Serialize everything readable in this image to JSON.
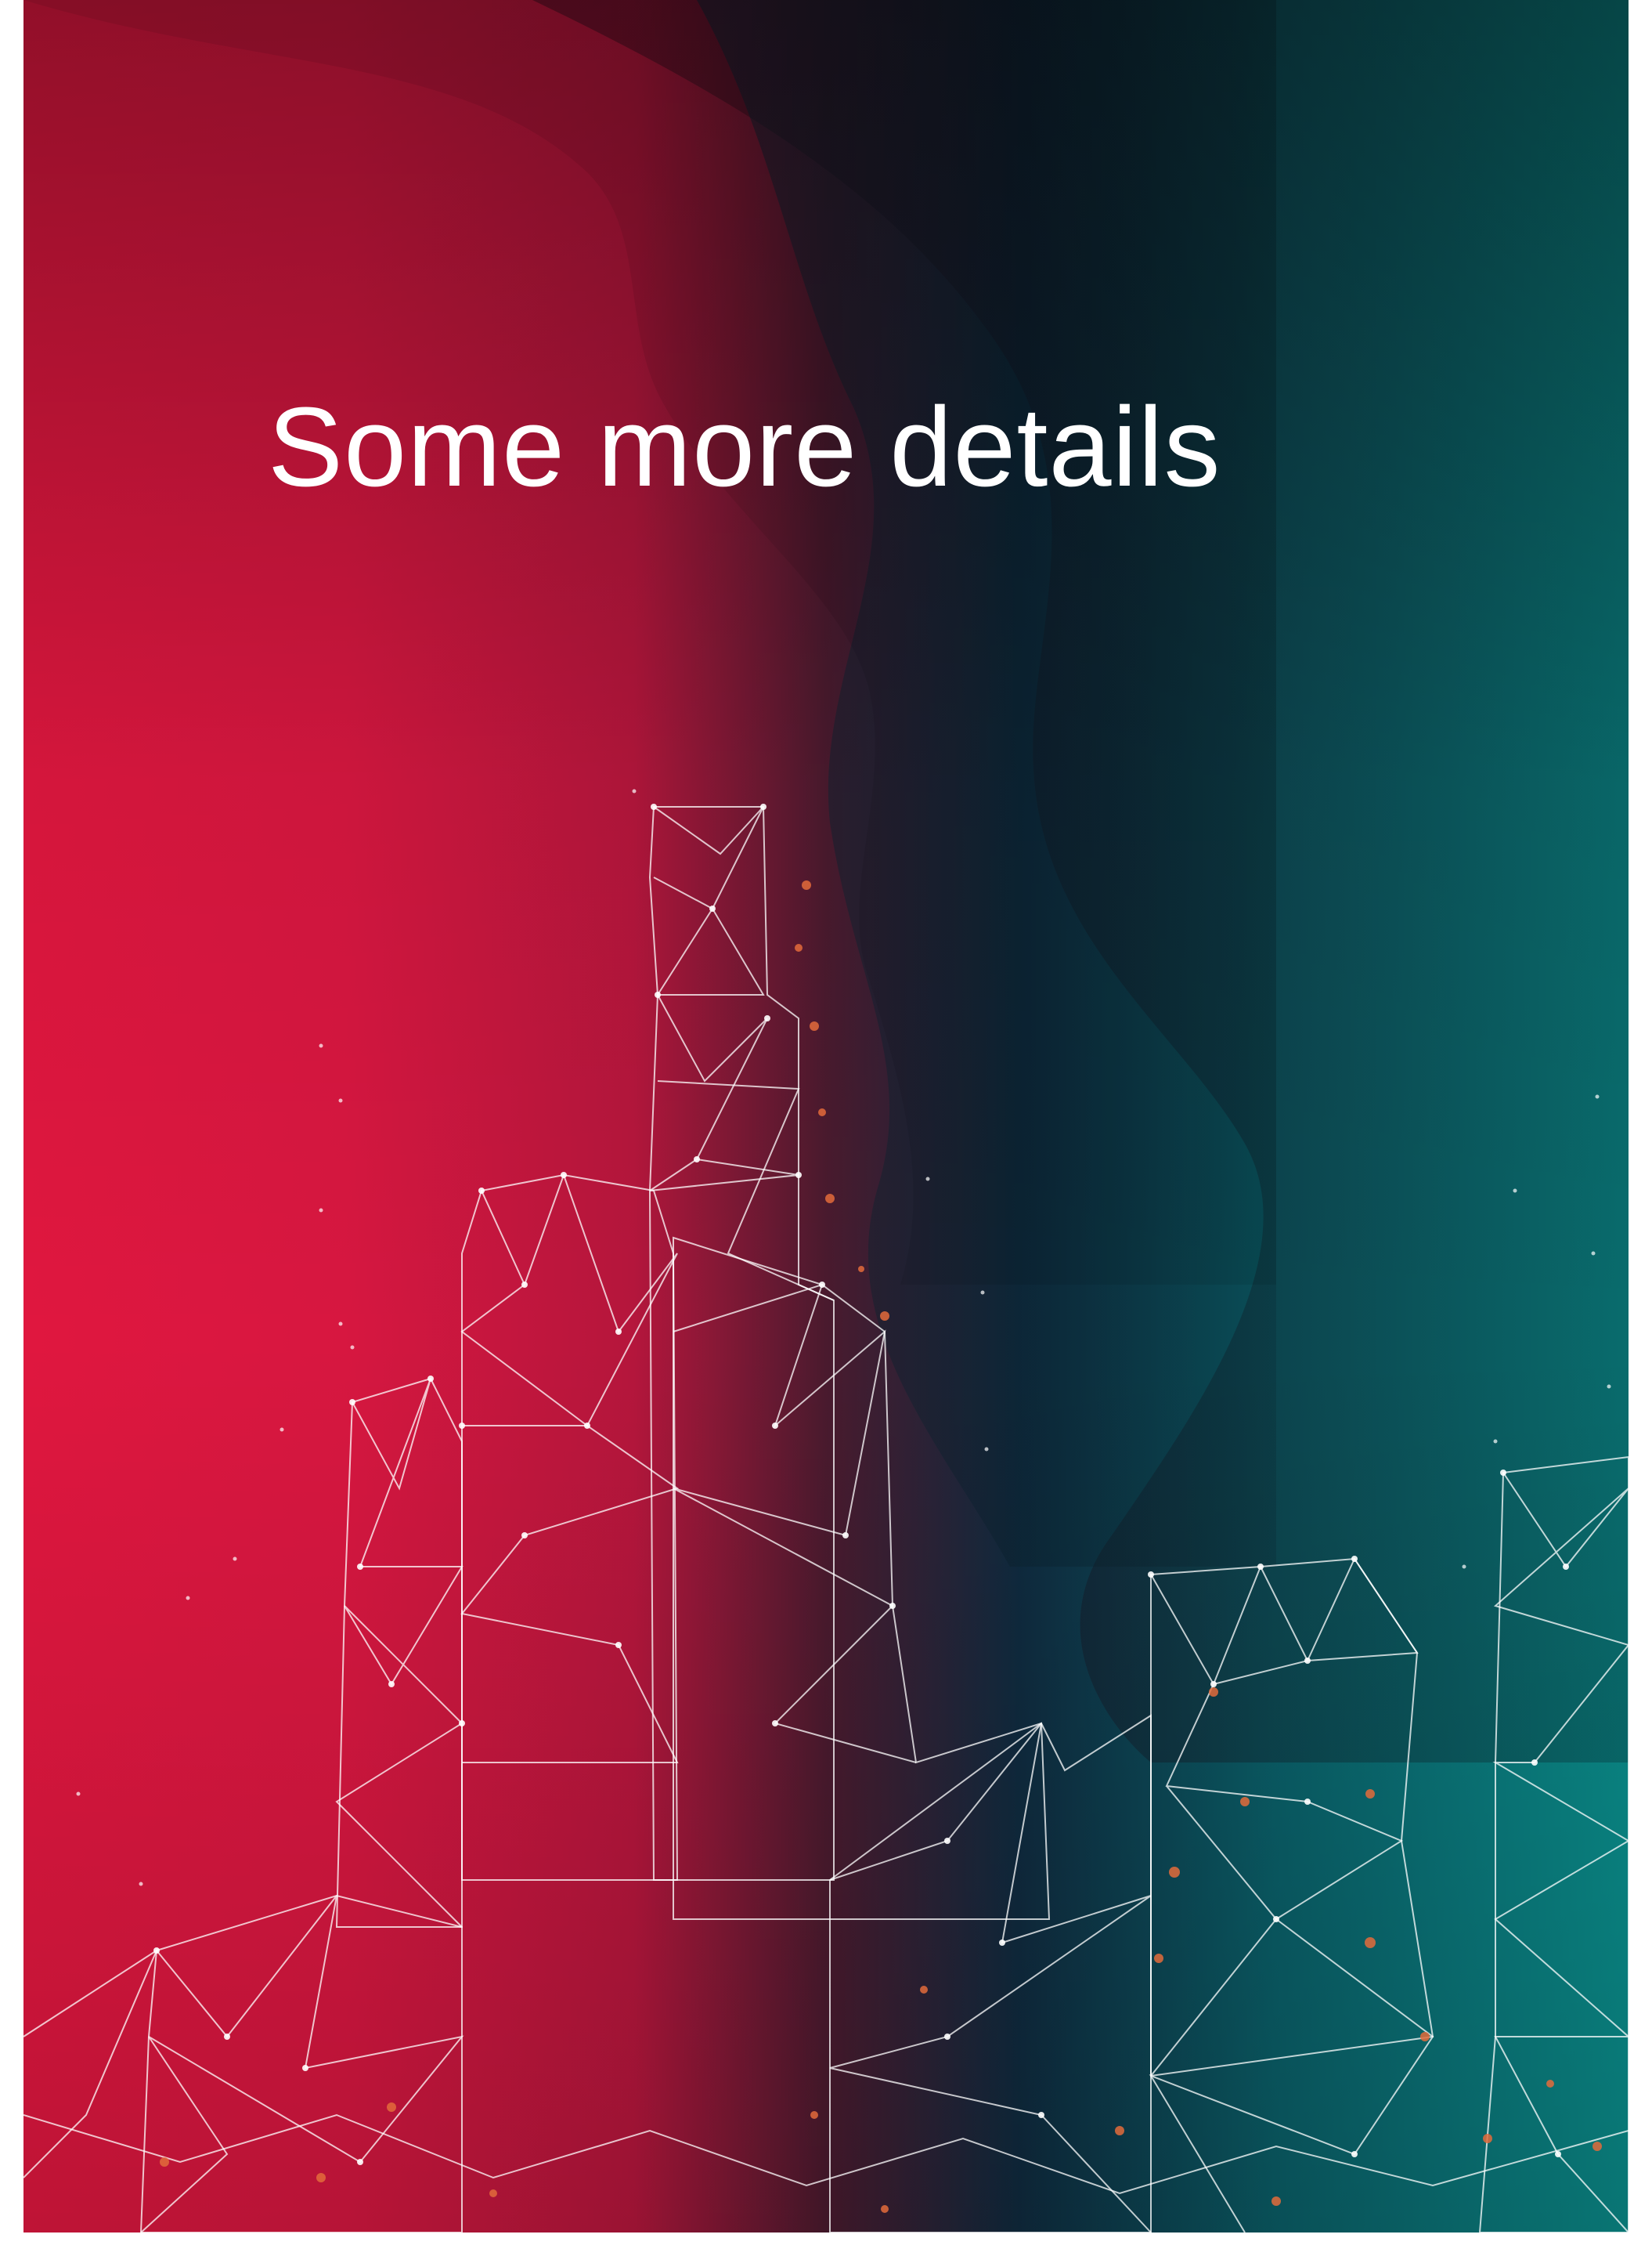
{
  "page": {
    "title": "Some more details"
  },
  "colors": {
    "left": "#e0173f",
    "middle": "#0f2a3e",
    "right": "#0a8a88",
    "mesh_line": "#ffffff",
    "node_accent": "#e36b3b"
  },
  "art": {
    "skyline_mesh": "network-skyline-illustration"
  }
}
